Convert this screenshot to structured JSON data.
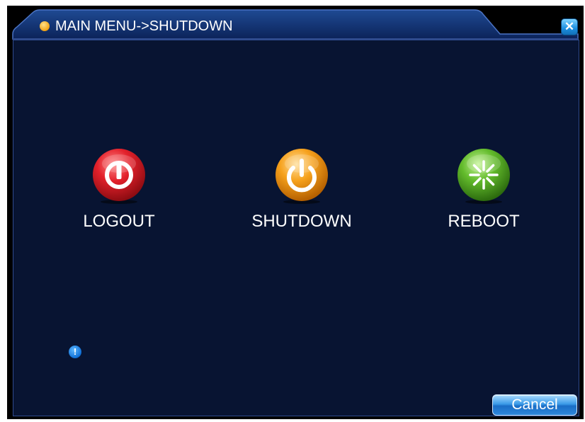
{
  "window": {
    "title": "MAIN MENU->SHUTDOWN"
  },
  "actions": [
    {
      "label": "LOGOUT",
      "icon": "logout-icon",
      "color": "#d81f2a"
    },
    {
      "label": "SHUTDOWN",
      "icon": "power-icon",
      "color": "#f59a14"
    },
    {
      "label": "REBOOT",
      "icon": "reboot-icon",
      "color": "#5cb82a"
    }
  ],
  "footer": {
    "cancel_label": "Cancel",
    "info_icon": "info-icon"
  },
  "colors": {
    "window_bg": "#081432",
    "title_bg": "#0d2a63",
    "border": "#2f4b8e"
  }
}
